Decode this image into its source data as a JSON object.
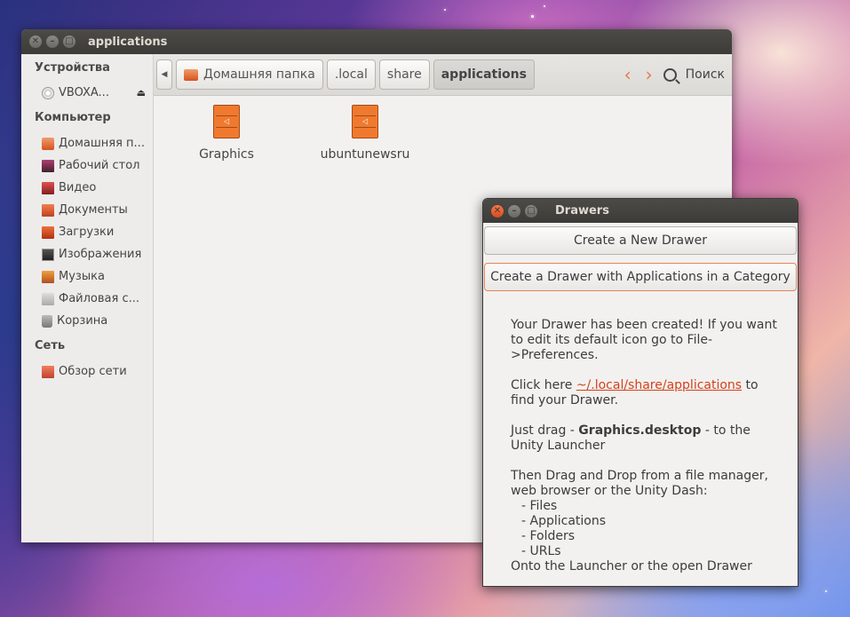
{
  "main_window": {
    "title": "applications",
    "sidebar": {
      "devices_header": "Устройства",
      "devices": [
        {
          "label": "VBOXA...",
          "icon": "disc-icon"
        }
      ],
      "computer_header": "Компьютер",
      "computer": [
        {
          "label": "Домашняя п...",
          "icon": "home-folder-icon"
        },
        {
          "label": "Рабочий стол",
          "icon": "desktop-icon"
        },
        {
          "label": "Видео",
          "icon": "video-icon"
        },
        {
          "label": "Документы",
          "icon": "documents-icon"
        },
        {
          "label": "Загрузки",
          "icon": "downloads-icon"
        },
        {
          "label": "Изображения",
          "icon": "pictures-icon"
        },
        {
          "label": "Музыка",
          "icon": "music-icon"
        },
        {
          "label": "Файловая с...",
          "icon": "filesystem-icon"
        },
        {
          "label": "Корзина",
          "icon": "trash-icon"
        }
      ],
      "network_header": "Сеть",
      "network": [
        {
          "label": "Обзор сети",
          "icon": "network-icon"
        }
      ]
    },
    "breadcrumbs": [
      "Домашняя папка",
      ".local",
      "share",
      "applications"
    ],
    "search_label": "Поиск",
    "files": [
      {
        "label": "Graphics",
        "icon": "drawer-icon"
      },
      {
        "label": "ubuntunewsru",
        "icon": "drawer-icon"
      }
    ]
  },
  "dialog": {
    "title": "Drawers",
    "button_new": "Create a New Drawer",
    "button_category": "Create a Drawer with Applications in a Category",
    "msg1": "Your Drawer has been created! If you want to edit its default icon go to File->Preferences.",
    "msg2_prefix": "Click here ",
    "msg2_link": "~/.local/share/applications",
    "msg2_suffix": " to find your Drawer.",
    "msg3_prefix": "Just drag - ",
    "msg3_bold": "Graphics.desktop",
    "msg3_suffix": " - to the Unity Launcher",
    "msg4": "Then Drag and Drop from a file manager, web browser or the Unity Dash:",
    "list": [
      "- Files",
      "- Applications",
      "- Folders",
      "- URLs"
    ],
    "msg5": "Onto the Launcher or the open Drawer"
  },
  "colors": {
    "accent": "#dd4814",
    "titlebar": "#3c3b37",
    "link": "#d4421a"
  }
}
